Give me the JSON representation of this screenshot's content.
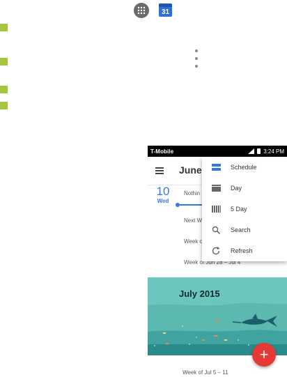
{
  "top_icons": {
    "apps": "apps-grid-icon",
    "calendar": "calendar-app-icon",
    "calendar_day": "31",
    "overflow": "more-vert-icon"
  },
  "phone": {
    "status_bar": {
      "carrier": "T-Mobile",
      "time": "3:24 PM"
    },
    "app_bar": {
      "title": "June"
    },
    "agenda": {
      "date_number": "10",
      "date_day": "Wed",
      "nothing_text": "Nothin",
      "next_week_text": "Next W",
      "week_partial_text": "Week o",
      "week_of_jun_text": "Week of Jun 28 – Jul 4"
    },
    "menu": {
      "items": [
        {
          "label": "Schedule",
          "icon": "schedule-view-icon"
        },
        {
          "label": "Day",
          "icon": "day-view-icon"
        },
        {
          "label": "5 Day",
          "icon": "five-day-view-icon"
        },
        {
          "label": "Search",
          "icon": "search-icon"
        },
        {
          "label": "Refresh",
          "icon": "refresh-icon"
        }
      ]
    },
    "banner": {
      "title": "July 2015"
    },
    "bottom_week_text": "Week of Jul 5 – 11",
    "fab_label": "+"
  },
  "colors": {
    "accent_blue": "#2f7be0",
    "bullet_green": "#a4c83a",
    "fab_red": "#e53935",
    "banner_teal": "#6cc6bd"
  }
}
